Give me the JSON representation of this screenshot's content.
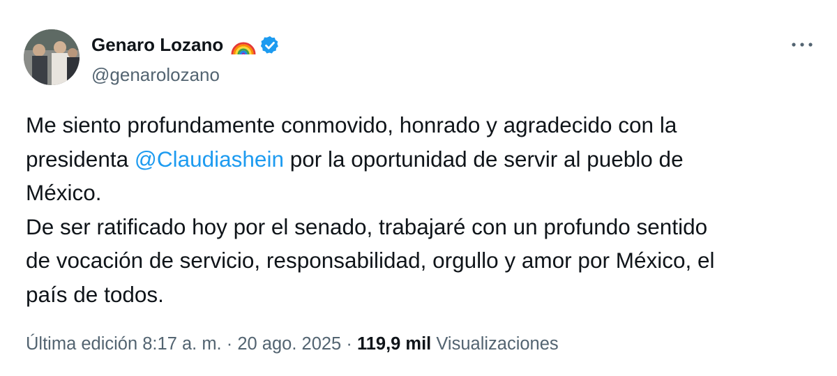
{
  "author": {
    "name": "Genaro Lozano",
    "handle": "@genarolozano",
    "name_icons": [
      "rainbow-flag-icon",
      "verified-badge-icon"
    ],
    "verified_color": "#1d9bf0"
  },
  "tweet": {
    "text_before_mention": "Me siento profundamente conmovido, honrado y agradecido con la\npresidenta ",
    "mention": "@Claudiashein",
    "text_after_mention": " por la oportunidad de servir al pueblo de\nMéxico.\nDe ser ratificado hoy por el senado, trabajaré con un profundo sentido\nde vocación de servicio, responsabilidad, orgullo y amor por México, el\npaís de todos."
  },
  "meta": {
    "edited_label": "Última edición",
    "time": "8:17 a. m.",
    "separator": "·",
    "date": "20 ago. 2025",
    "views_count": "119,9 mil",
    "views_label": "Visualizaciones"
  },
  "menu": {
    "icon": "more-options-icon"
  },
  "colors": {
    "text": "#0f1419",
    "secondary": "#536471",
    "link": "#1d9bf0"
  }
}
